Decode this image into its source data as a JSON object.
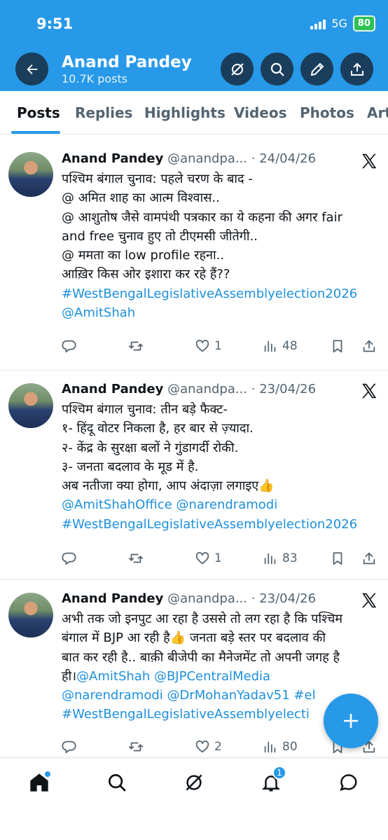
{
  "status_bar": {
    "time": "9:51",
    "network": "5G",
    "battery": "80"
  },
  "header": {
    "name": "Anand Pandey",
    "post_count": "10.7K posts"
  },
  "tabs": [
    "Posts",
    "Replies",
    "Highlights",
    "Videos",
    "Photos",
    "Art"
  ],
  "tweets": [
    {
      "name": "Anand Pandey",
      "handle": "@anandpa...",
      "date": "· 24/04/26",
      "lines": [
        {
          "text": "पश्चिम बंगाल चुनाव: पहले चरण के बाद -",
          "link": false
        },
        {
          "text": "@ अमित शाह का आत्म विश्वास..",
          "link": false
        },
        {
          "text": "@ आशुतोष जैसे वामपंथी पत्रकार का ये कहना की अगर fair",
          "link": false
        },
        {
          "text": "and free चुनाव हुए तो टीएमसी जीतेगी..",
          "link": false
        },
        {
          "text": "@ ममता का low profile रहना..",
          "link": false
        },
        {
          "text": "आख़िर किस ओर इशारा कर रहे हैं??",
          "link": false
        },
        {
          "text": "#WestBengalLegislativeAssemblyelection2026",
          "link": true
        },
        {
          "text": "@AmitShah",
          "link": true
        }
      ],
      "replies": "",
      "retweets": "",
      "likes": "1",
      "views": "48"
    },
    {
      "name": "Anand Pandey",
      "handle": "@anandpa...",
      "date": "· 23/04/26",
      "lines": [
        {
          "text": "पश्चिम बंगाल चुनाव: तीन बड़े फैक्ट-",
          "link": false
        },
        {
          "text": "१- हिंदू वोटर निकला है, हर बार से ज़्यादा.",
          "link": false
        },
        {
          "text": "२- केंद्र के सुरक्षा बलों ने गुंडागर्दी रोकी.",
          "link": false
        },
        {
          "text": "३- जनता बदलाव के मूड में है.",
          "link": false
        },
        {
          "text": "अब नतीजा क्या होगा, आप अंदाज़ा लगाइए👍",
          "link": false
        },
        {
          "text": "@AmitShahOffice @narendramodi",
          "link": true
        },
        {
          "text": "#WestBengalLegislativeAssemblyelection2026",
          "link": true
        }
      ],
      "replies": "",
      "retweets": "",
      "likes": "1",
      "views": "83"
    },
    {
      "name": "Anand Pandey",
      "handle": "@anandpa...",
      "date": "· 23/04/26",
      "lines": [
        {
          "text": "अभी तक जो इनपुट आ रहा है उससे तो लग रहा है कि पश्चिम",
          "link": false
        },
        {
          "text": "बंगाल में BJP आ रही है👍 जनता बड़े स्तर पर बदलाव की",
          "link": false
        },
        {
          "text": "बात कर रही है.. बाक़ी बीजेपी का मैनेजमेंट तो अपनी जगह है",
          "link": false
        },
        {
          "text": "ही।",
          "link": false,
          "tail": "@AmitShah @BJPCentralMedia"
        },
        {
          "text": "@narendramodi @DrMohanYadav51 #el",
          "link": true
        },
        {
          "text": "#WestBengalLegislativeAssemblyelecti",
          "link": true
        }
      ],
      "replies": "",
      "retweets": "",
      "likes": "2",
      "views": "80"
    }
  ],
  "bottom_nav": {
    "notifications_badge": "1"
  },
  "colors": {
    "brand": "#2799e8",
    "link": "#1d8fdc",
    "text": "#0f1419",
    "muted": "#536471"
  },
  "icons": [
    "back-arrow-icon",
    "grok-icon",
    "search-icon",
    "edit-icon",
    "share-icon",
    "x-logo-icon",
    "reply-icon",
    "retweet-icon",
    "like-icon",
    "views-icon",
    "bookmark-icon",
    "home-icon",
    "bell-icon",
    "messages-icon",
    "plus-icon"
  ]
}
